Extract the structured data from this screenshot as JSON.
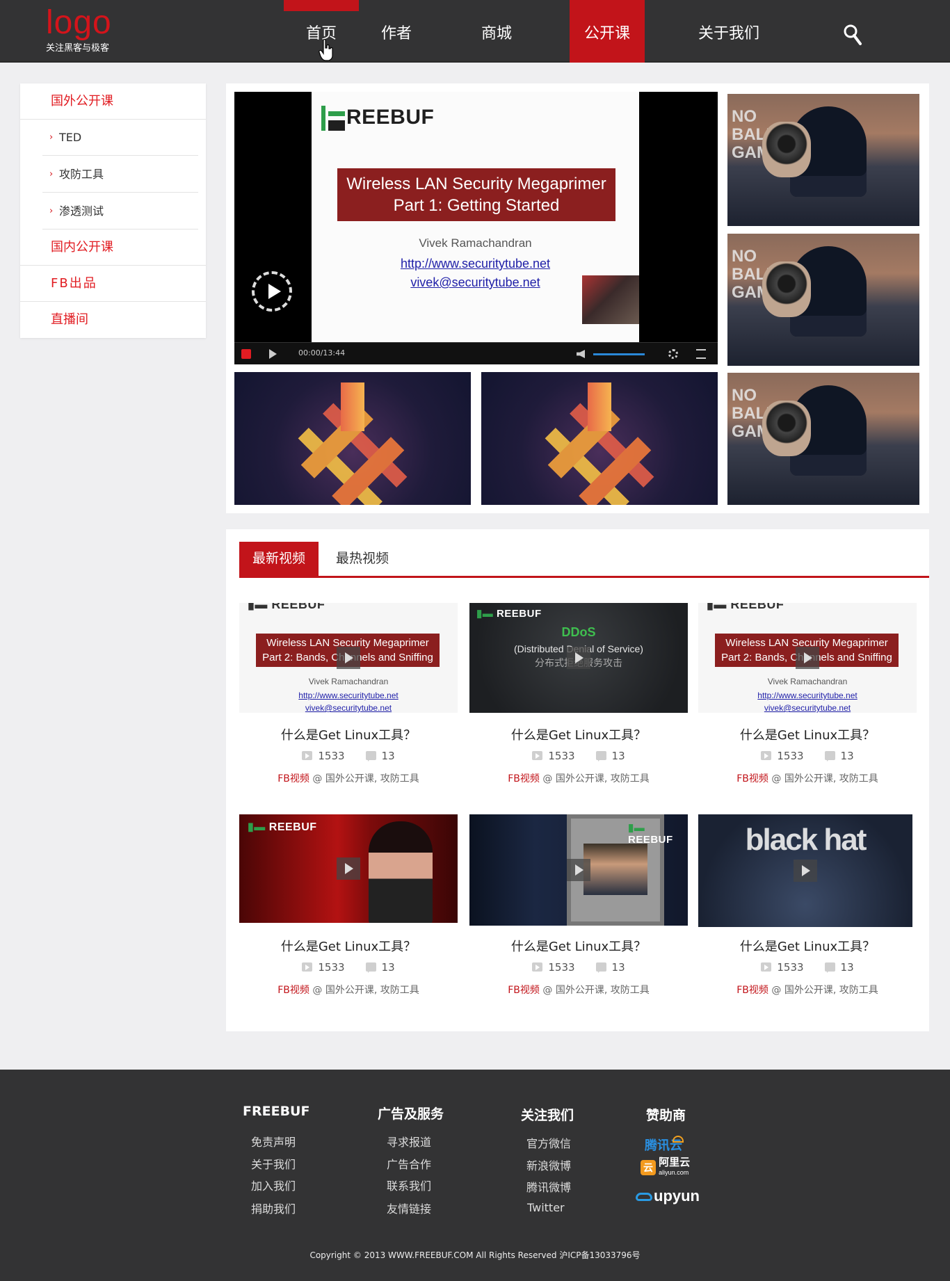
{
  "header": {
    "logo": "logo",
    "tagline": "关注黑客与极客",
    "nav": [
      "首页",
      "作者",
      "商城",
      "公开课",
      "关于我们"
    ],
    "active_nav": "公开课"
  },
  "sidebar": {
    "categories": [
      {
        "label": "国外公开课",
        "children": [
          "TED",
          "攻防工具",
          "渗透测试"
        ]
      },
      {
        "label": "国内公开课"
      },
      {
        "label": "FB出品"
      },
      {
        "label": "直播间"
      }
    ]
  },
  "featured": {
    "player": {
      "brand": "REEBUF",
      "slide_title_line1": "Wireless LAN Security Megaprimer",
      "slide_title_line2": "Part 1: Getting Started",
      "author": "Vivek Ramachandran",
      "link1": "http://www.securitytube.net",
      "link2": "vivek@securitytube.net",
      "time": "00:00/13:44"
    }
  },
  "videos": {
    "tabs": [
      "最新视频",
      "最热视频"
    ],
    "items": [
      {
        "title": "什么是Get Linux工具？",
        "views": "1533",
        "comments": "13",
        "source": "FB视频",
        "tags": "@ 国外公开课, 攻防工具",
        "thumb": {
          "l1": "Wireless LAN Security Megaprimer",
          "l2": "Part 2: Bands, Channels and Sniffing",
          "author": "Vivek Ramachandran",
          "url1": "http://www.securitytube.net",
          "url2": "vivek@securitytube.net"
        }
      },
      {
        "title": "什么是Get Linux工具？",
        "views": "1533",
        "comments": "13",
        "source": "FB视频",
        "tags": "@ 国外公开课, 攻防工具",
        "thumb": {
          "brand": "REEBUF",
          "h": "DDoS",
          "sub": "(Distributed Denial of Service)",
          "cn": "分布式拒绝服务攻击"
        }
      },
      {
        "title": "什么是Get Linux工具？",
        "views": "1533",
        "comments": "13",
        "source": "FB视频",
        "tags": "@ 国外公开课, 攻防工具",
        "thumb": {
          "l1": "Wireless LAN Security Megaprimer",
          "l2": "Part 2: Bands, Channels and Sniffing",
          "author": "Vivek Ramachandran",
          "url1": "http://www.securitytube.net",
          "url2": "vivek@securitytube.net"
        }
      },
      {
        "title": "什么是Get Linux工具？",
        "views": "1533",
        "comments": "13",
        "source": "FB视频",
        "tags": "@ 国外公开课, 攻防工具",
        "thumb": {
          "brand": "REEBUF"
        }
      },
      {
        "title": "什么是Get Linux工具？",
        "views": "1533",
        "comments": "13",
        "source": "FB视频",
        "tags": "@ 国外公开课, 攻防工具",
        "thumb": {
          "brand": "REEBUF"
        }
      },
      {
        "title": "什么是Get Linux工具？",
        "views": "1533",
        "comments": "13",
        "source": "FB视频",
        "tags": "@ 国外公开课, 攻防工具",
        "thumb": {
          "brand": "black hat"
        }
      }
    ]
  },
  "footer": {
    "columns": [
      {
        "heading": "FREEBUF",
        "links": [
          "免责声明",
          "关于我们",
          "加入我们",
          "捐助我们"
        ]
      },
      {
        "heading": "广告及服务",
        "links": [
          "寻求报道",
          "广告合作",
          "联系我们",
          "友情链接"
        ]
      },
      {
        "heading": "关注我们",
        "links": [
          "官方微信",
          "新浪微博",
          "腾讯微博",
          "Twitter"
        ]
      },
      {
        "heading": "赞助商",
        "sponsors": [
          "腾讯云",
          "阿里云",
          "aliyun.com",
          "upyun"
        ]
      }
    ],
    "copyright": "Copyright © 2013 WWW.FREEBUF.COM All Rights Reserved 沪ICP备13033796号"
  },
  "colors": {
    "accent": "#c2141a",
    "header_bg": "#333334",
    "page_bg": "#efeff1"
  }
}
